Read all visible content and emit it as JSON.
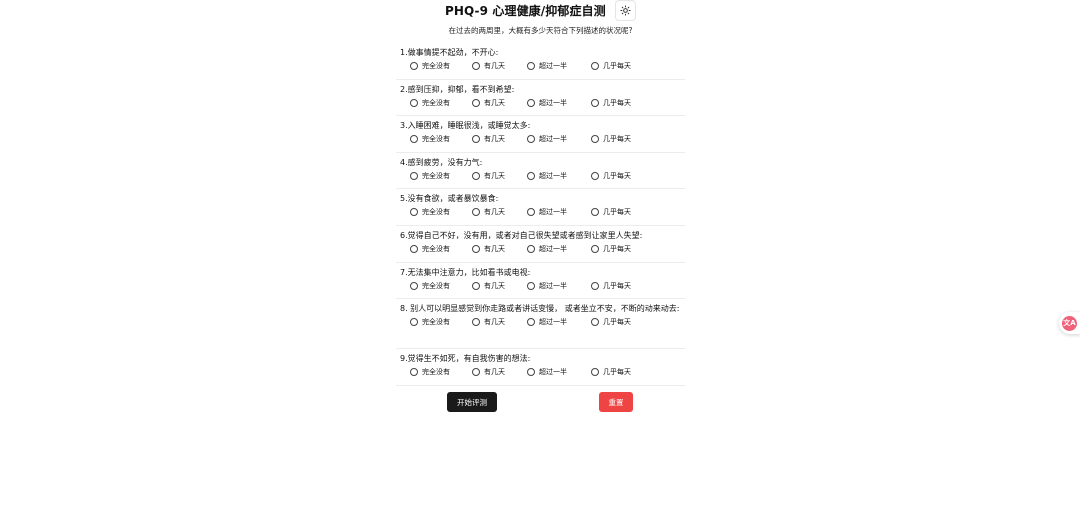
{
  "header": {
    "title": "PHQ-9 心理健康/抑郁症自测",
    "theme_toggle_icon": "sun-icon"
  },
  "subtitle": "在过去的两周里，大概有多少天符合下列描述的状况呢?",
  "options": [
    "完全没有",
    "有几天",
    "超过一半",
    "几乎每天"
  ],
  "questions": [
    {
      "text": "1.做事情提不起劲，不开心:"
    },
    {
      "text": "2.感到压抑，抑郁，看不到希望:"
    },
    {
      "text": "3.入睡困难，睡眠很浅，或睡觉太多:"
    },
    {
      "text": "4.感到疲劳，没有力气:"
    },
    {
      "text": "5.没有食欲，或者暴饮暴食:"
    },
    {
      "text": "6.觉得自己不好，没有用，或者对自己很失望或者感到让家里人失望:"
    },
    {
      "text": "7.无法集中注意力，比如看书或电视:"
    },
    {
      "text": "8. 别人可以明显感觉到你走路或者讲话变慢， 或者坐立不安，不断的动来动去:"
    },
    {
      "text": "9.觉得生不如死，有自我伤害的想法:"
    }
  ],
  "actions": {
    "start_label": "开始评测",
    "reset_label": "重置"
  },
  "colors": {
    "start_button": "#1a1a1a",
    "reset_button": "#ef4444",
    "float_widget": "#f0627a"
  },
  "float_widget": {
    "icon": "translate-icon",
    "label": "文A"
  }
}
